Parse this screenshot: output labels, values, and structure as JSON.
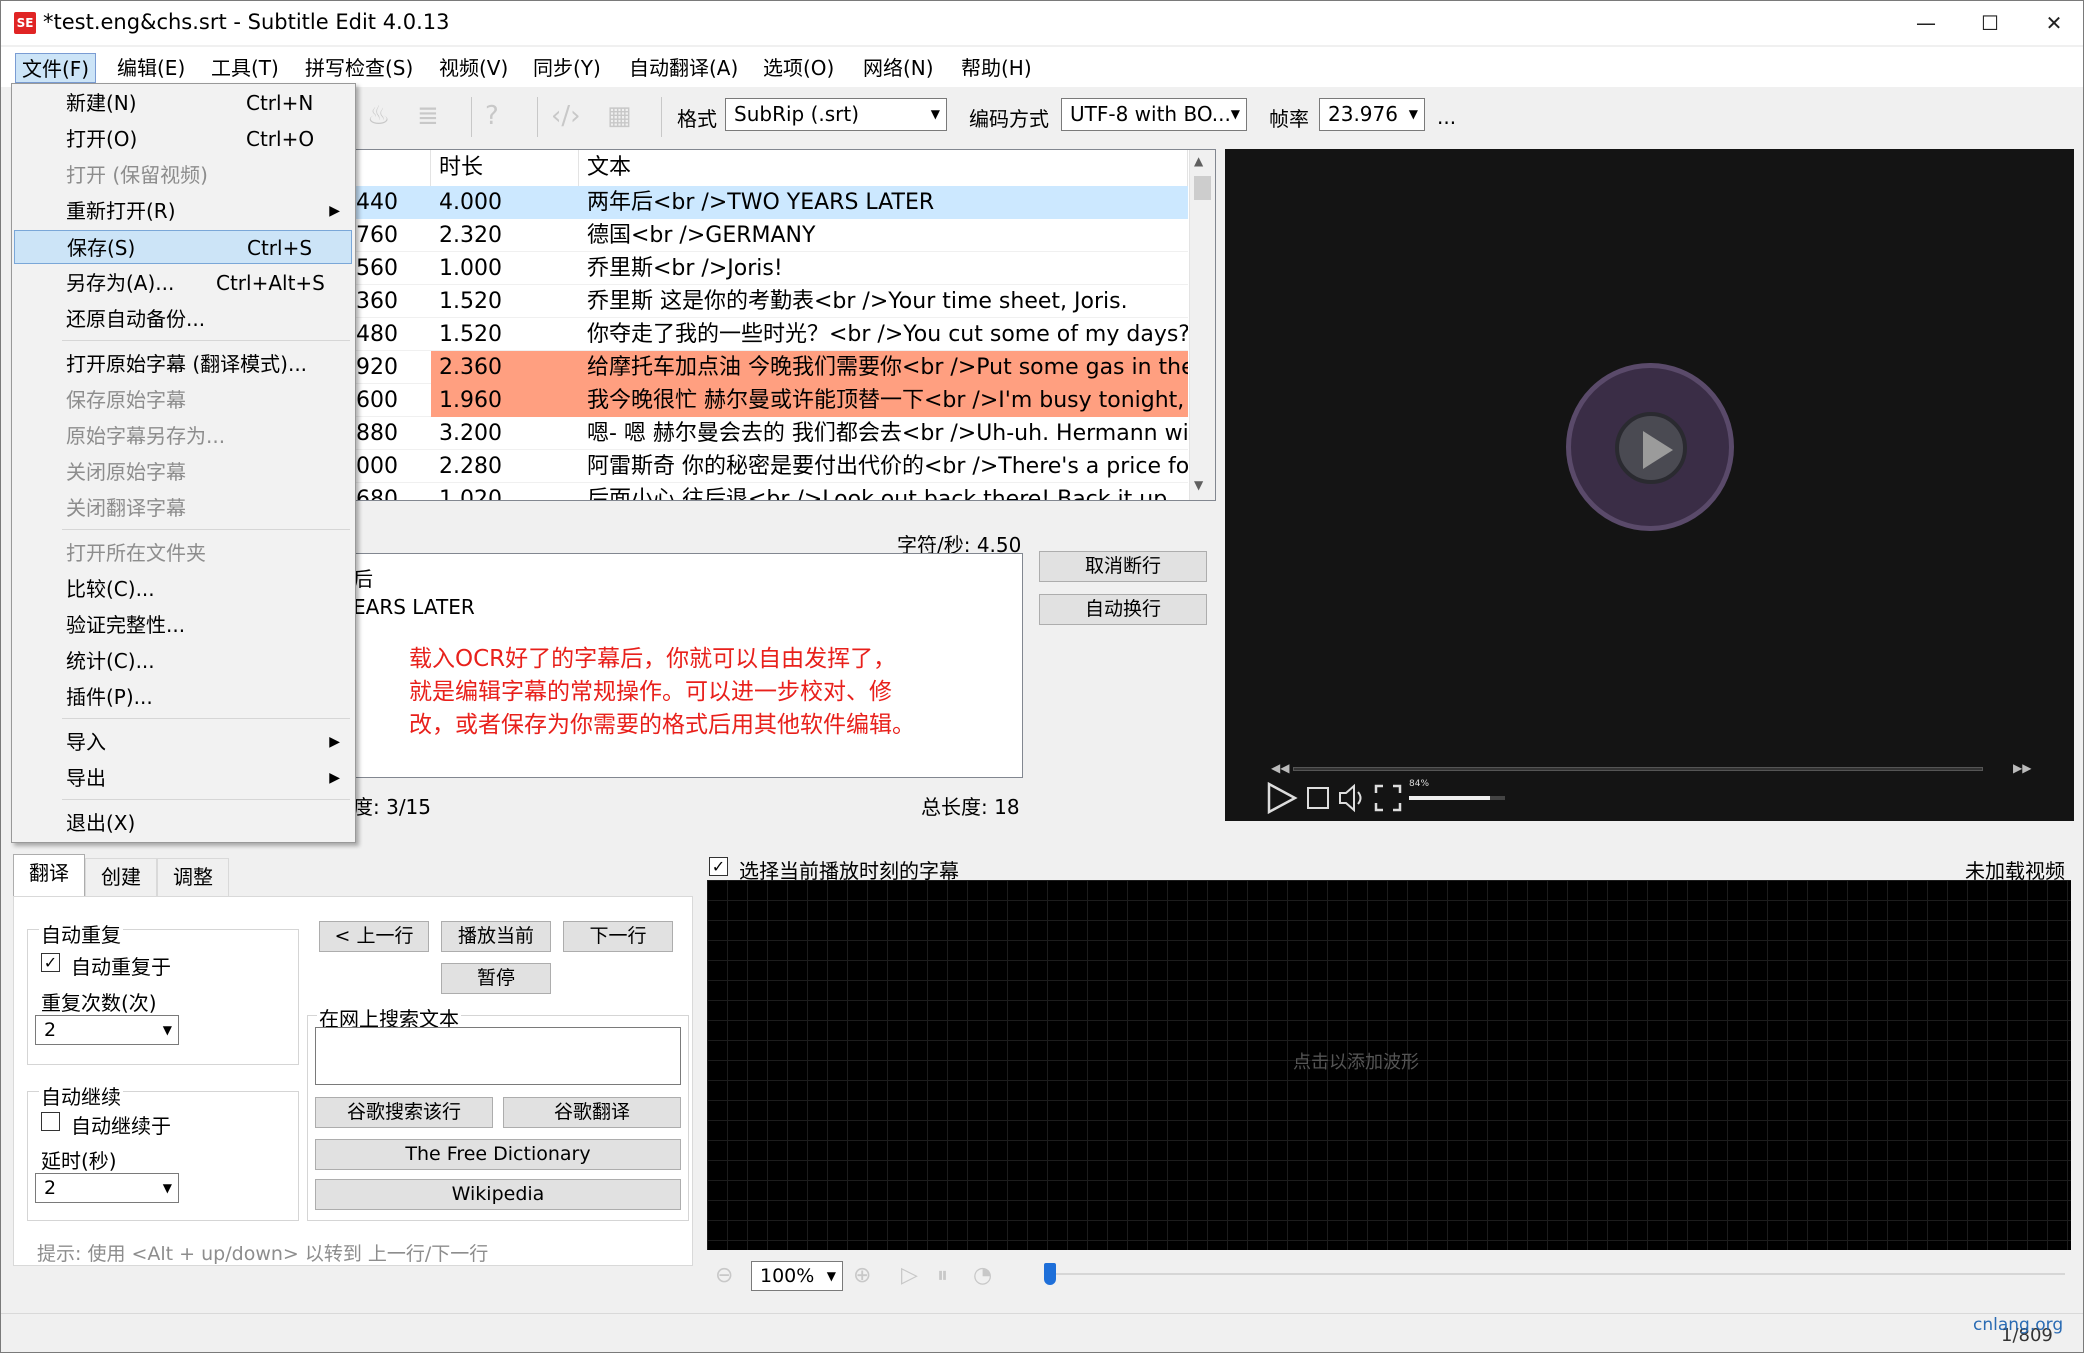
{
  "window": {
    "title": "*test.eng&chs.srt - Subtitle Edit 4.0.13",
    "app_icon": "SE",
    "minimize": "—",
    "maximize": "☐",
    "close": "✕"
  },
  "menubar": [
    "文件(F)",
    "编辑(E)",
    "工具(T)",
    "拼写检查(S)",
    "视频(V)",
    "同步(Y)",
    "自动翻译(A)",
    "选项(O)",
    "网络(N)",
    "帮助(H)"
  ],
  "toolbar": {
    "format_label": "格式",
    "format_value": "SubRip (.srt)",
    "encoding_label": "编码方式",
    "encoding_value": "UTF-8 with BO...",
    "fps_label": "帧率",
    "fps_value": "23.976",
    "more": "..."
  },
  "grid": {
    "headers": [
      "时长",
      "文本"
    ],
    "rows": [
      {
        "end": "440",
        "dur": "4.000",
        "text": "两年后<br />TWO YEARS LATER",
        "state": "selected"
      },
      {
        "end": "760",
        "dur": "2.320",
        "text": "德国<br />GERMANY",
        "state": ""
      },
      {
        "end": "560",
        "dur": "1.000",
        "text": "乔里斯<br />Joris!",
        "state": ""
      },
      {
        "end": "360",
        "dur": "1.520",
        "text": "乔里斯 这是你的考勤表<br />Your time sheet, Joris.",
        "state": ""
      },
      {
        "end": "480",
        "dur": "1.520",
        "text": "你夺走了我的一些时光？<br />You cut some of my days?",
        "state": ""
      },
      {
        "end": "920",
        "dur": "2.360",
        "text": "给摩托车加点油 今晚我们需要你<br />Put some gas in the...",
        "state": "warn"
      },
      {
        "end": "600",
        "dur": "1.960",
        "text": "我今晚很忙 赫尔曼或许能顶替一下<br />I'm busy tonight, ...",
        "state": "warn"
      },
      {
        "end": "880",
        "dur": "3.200",
        "text": "嗯- 嗯 赫尔曼会去的 我们都会去<br />Uh-uh. Hermann will...",
        "state": ""
      },
      {
        "end": "000",
        "dur": "2.280",
        "text": "阿雷斯奇 你的秘密是要付出代价的<br />There's a price fo...",
        "state": ""
      },
      {
        "end": "680",
        "dur": "1.020",
        "text": "后面小心 往后退<br />Look out back there! Back it up.",
        "state": ""
      }
    ]
  },
  "editor": {
    "chars_per_sec": "字符/秒: 4.50",
    "line1": "后",
    "line2": "EARS LATER",
    "annotation": [
      "载入OCR好了的字幕后，你就可以自由发挥了，",
      "就是编辑字幕的常规操作。可以进一步校对、修",
      "改，或者保存为你需要的格式后用其他软件编辑。"
    ],
    "single_line_len": "度: 3/15",
    "total_len": "总长度: 18",
    "unbreak_btn": "取消断行",
    "autobreak_btn": "自动换行"
  },
  "video_controls": {
    "volume_pct": "84%",
    "volume_level": 0.84
  },
  "tabs": [
    "翻译",
    "创建",
    "调整"
  ],
  "translate_panel": {
    "auto_repeat_group": "自动重复",
    "auto_repeat_check": "自动重复于",
    "repeat_count_label": "重复次数(次)",
    "repeat_count_value": "2",
    "auto_continue_group": "自动继续",
    "auto_continue_check": "自动继续于",
    "delay_label": "延时(秒)",
    "delay_value": "2",
    "prev_btn": "< 上一行",
    "play_btn": "播放当前",
    "next_btn": "下一行",
    "pause_btn": "暂停",
    "search_group": "在网上搜索文本",
    "google_search_btn": "谷歌搜索该行",
    "google_translate_btn": "谷歌翻译",
    "dictionary_btn": "The Free Dictionary",
    "wikipedia_btn": "Wikipedia",
    "hint": "提示: 使用 <Alt + up/down> 以转到 上一行/下一行"
  },
  "waveform": {
    "select_current": "选择当前播放时刻的字幕",
    "no_video": "未加载视频",
    "click_to_add": "点击以添加波形",
    "zoom": "100%"
  },
  "status": {
    "position": "1/809",
    "watermark": "cnlang.org"
  },
  "file_menu": {
    "items": [
      {
        "label": "新建(N)",
        "shortcut": "Ctrl+N",
        "state": ""
      },
      {
        "label": "打开(O)",
        "shortcut": "Ctrl+O",
        "state": ""
      },
      {
        "label": "打开 (保留视频)",
        "shortcut": "",
        "state": "disabled"
      },
      {
        "label": "重新打开(R)",
        "shortcut": "",
        "state": "submenu"
      },
      {
        "label": "保存(S)",
        "shortcut": "Ctrl+S",
        "state": "highlight"
      },
      {
        "label": "另存为(A)...",
        "shortcut": "Ctrl+Alt+S",
        "state": ""
      },
      {
        "label": "还原自动备份...",
        "shortcut": "",
        "state": ""
      },
      {
        "label": "打开原始字幕 (翻译模式)...",
        "shortcut": "",
        "state": ""
      },
      {
        "label": "保存原始字幕",
        "shortcut": "",
        "state": "disabled"
      },
      {
        "label": "原始字幕另存为...",
        "shortcut": "",
        "state": "disabled"
      },
      {
        "label": "关闭原始字幕",
        "shortcut": "",
        "state": "disabled"
      },
      {
        "label": "关闭翻译字幕",
        "shortcut": "",
        "state": "disabled"
      },
      {
        "label": "打开所在文件夹",
        "shortcut": "",
        "state": "disabled"
      },
      {
        "label": "比较(C)...",
        "shortcut": "",
        "state": ""
      },
      {
        "label": "验证完整性...",
        "shortcut": "",
        "state": ""
      },
      {
        "label": "统计(C)...",
        "shortcut": "",
        "state": ""
      },
      {
        "label": "插件(P)...",
        "shortcut": "",
        "state": ""
      },
      {
        "label": "导入",
        "shortcut": "",
        "state": "submenu"
      },
      {
        "label": "导出",
        "shortcut": "",
        "state": "submenu"
      },
      {
        "label": "退出(X)",
        "shortcut": "",
        "state": ""
      }
    ]
  }
}
